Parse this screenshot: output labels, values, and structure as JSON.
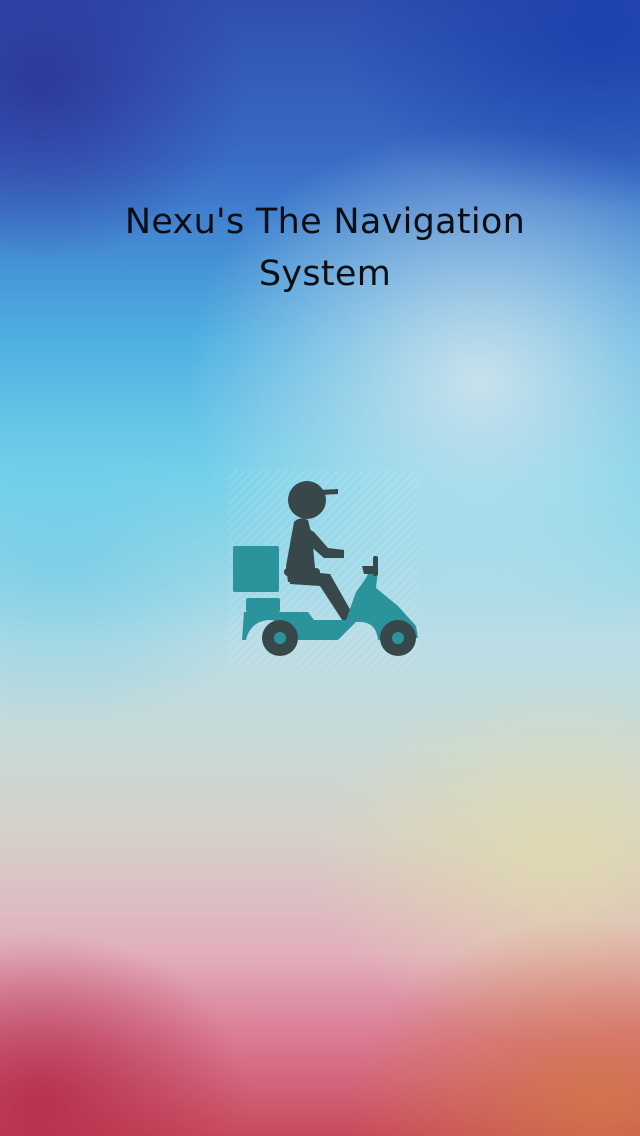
{
  "splash": {
    "title": "Nexu's The Navigation System",
    "logo_icon": "delivery-scooter-icon",
    "colors": {
      "icon_dark": "#37474a",
      "icon_teal": "#2a939c"
    }
  }
}
